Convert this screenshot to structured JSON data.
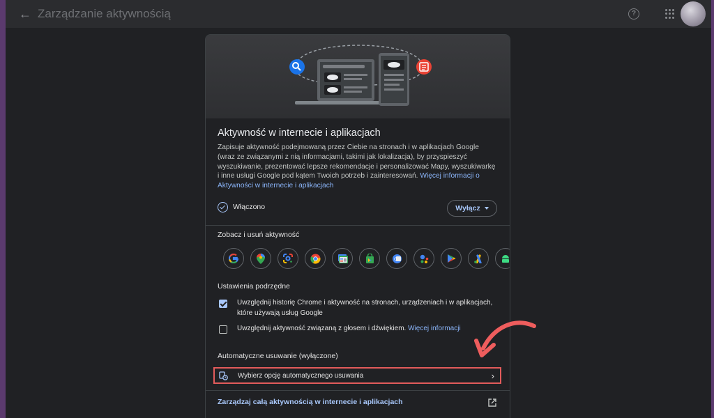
{
  "header": {
    "title": "Zarządzanie aktywnością"
  },
  "card": {
    "title": "Aktywność w internecie i aplikacjach",
    "description": "Zapisuje aktywność podejmowaną przez Ciebie na stronach i w aplikacjach Google (wraz ze związanymi z nią informacjami, takimi jak lokalizacja), by przyspieszyć wyszukiwanie, prezentować lepsze rekomendacje i personalizować Mapy, wyszukiwarkę i inne usługi Google pod kątem Twoich potrzeb i zainteresowań.",
    "learn_more": "Więcej informacji o Aktywności w internecie i aplikacjach",
    "status": "Włączono",
    "off_button": "Wyłącz"
  },
  "see_delete": {
    "heading": "Zobacz i usuń aktywność",
    "apps": [
      "google-icon",
      "maps-icon",
      "lens-icon",
      "chrome-icon",
      "news-icon",
      "play-store-bag-icon",
      "translate-icon",
      "assistant-icon",
      "play-icon",
      "ads-icon",
      "android-icon"
    ]
  },
  "subsettings": {
    "heading": "Ustawienia podrzędne",
    "items": [
      {
        "label": "Uwzględnij historię Chrome i aktywność na stronach, urządzeniach i w aplikacjach, które używają usług Google",
        "link": "",
        "checked": true
      },
      {
        "label": "Uwzględnij aktywność związaną z głosem i dźwiękiem.",
        "link": "Więcej informacji",
        "checked": false
      }
    ]
  },
  "auto_delete": {
    "heading": "Automatyczne usuwanie (wyłączone)",
    "option": "Wybierz opcję automatycznego usuwania"
  },
  "footer": {
    "manage_link": "Zarządzaj całą aktywnością w internecie i aplikacjach"
  },
  "colors": {
    "accent": "#a8c7fa",
    "highlight": "#e35b5b",
    "background": "#202124"
  }
}
